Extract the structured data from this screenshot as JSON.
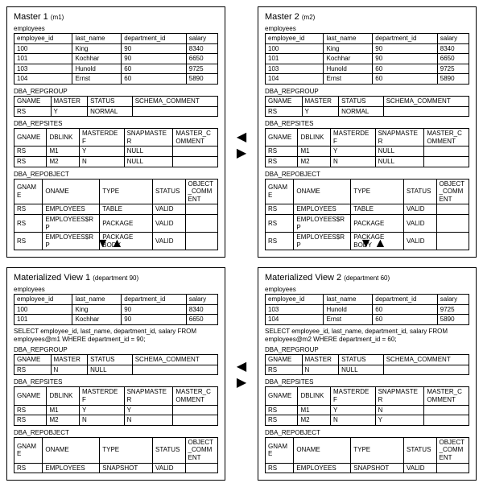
{
  "panels": {
    "master1": {
      "title": "Master 1",
      "sub": "(m1)",
      "emp_label": "employees",
      "emp_headers": [
        "employee_id",
        "last_name",
        "department_id",
        "salary"
      ],
      "emp_rows": [
        [
          "100",
          "King",
          "90",
          "8340"
        ],
        [
          "101",
          "Kochhar",
          "90",
          "6650"
        ],
        [
          "103",
          "Hunold",
          "60",
          "9725"
        ],
        [
          "104",
          "Ernst",
          "60",
          "5890"
        ]
      ],
      "repgroup_label": "DBA_REPGROUP",
      "repgroup_headers": [
        "GNAME",
        "MASTER",
        "STATUS",
        "SCHEMA_COMMENT"
      ],
      "repgroup_rows": [
        [
          "RS",
          "Y",
          "NORMAL",
          ""
        ]
      ],
      "repsites_label": "DBA_REPSITES",
      "repsites_headers": [
        "GNAME",
        "DBLINK",
        "MASTERDEF",
        "SNAPMASTER",
        "MASTER_COMMENT"
      ],
      "repsites_rows": [
        [
          "RS",
          "M1",
          "Y",
          "NULL",
          ""
        ],
        [
          "RS",
          "M2",
          "N",
          "NULL",
          ""
        ]
      ],
      "repobject_label": "DBA_REPOBJECT",
      "repobject_headers": [
        "GNAME",
        "ONAME",
        "TYPE",
        "STATUS",
        "OBJECT_COMMENT"
      ],
      "repobject_rows": [
        [
          "RS",
          "EMPLOYEES",
          "TABLE",
          "VALID",
          ""
        ],
        [
          "RS",
          "EMPLOYEES$RP",
          "PACKAGE",
          "VALID",
          ""
        ],
        [
          "RS",
          "EMPLOYEES$RP",
          "PACKAGE BODY",
          "VALID",
          ""
        ]
      ]
    },
    "master2": {
      "title": "Master 2",
      "sub": "(m2)",
      "emp_label": "employees",
      "emp_headers": [
        "employee_id",
        "last_name",
        "department_id",
        "salary"
      ],
      "emp_rows": [
        [
          "100",
          "King",
          "90",
          "8340"
        ],
        [
          "101",
          "Kochhar",
          "90",
          "6650"
        ],
        [
          "103",
          "Hunold",
          "60",
          "9725"
        ],
        [
          "104",
          "Ernst",
          "60",
          "5890"
        ]
      ],
      "repgroup_label": "DBA_REPGROUP",
      "repgroup_headers": [
        "GNAME",
        "MASTER",
        "STATUS",
        "SCHEMA_COMMENT"
      ],
      "repgroup_rows": [
        [
          "RS",
          "Y",
          "NORMAL",
          ""
        ]
      ],
      "repsites_label": "DBA_REPSITES",
      "repsites_headers": [
        "GNAME",
        "DBLINK",
        "MASTERDEF",
        "SNAPMASTER",
        "MASTER_COMMENT"
      ],
      "repsites_rows": [
        [
          "RS",
          "M1",
          "Y",
          "NULL",
          ""
        ],
        [
          "RS",
          "M2",
          "N",
          "NULL",
          ""
        ]
      ],
      "repobject_label": "DBA_REPOBJECT",
      "repobject_headers": [
        "GNAME",
        "ONAME",
        "TYPE",
        "STATUS",
        "OBJECT_COMMENT"
      ],
      "repobject_rows": [
        [
          "RS",
          "EMPLOYEES",
          "TABLE",
          "VALID",
          ""
        ],
        [
          "RS",
          "EMPLOYEES$RP",
          "PACKAGE",
          "VALID",
          ""
        ],
        [
          "RS",
          "EMPLOYEES$RP",
          "PACKAGE BODY",
          "VALID",
          ""
        ]
      ]
    },
    "mv1": {
      "title": "Materialized View 1",
      "sub": "(department 90)",
      "emp_label": "employees",
      "emp_headers": [
        "employee_id",
        "last_name",
        "department_id",
        "salary"
      ],
      "emp_rows": [
        [
          "100",
          "King",
          "90",
          "8340"
        ],
        [
          "101",
          "Kochhar",
          "90",
          "6650"
        ]
      ],
      "sql": "SELECT employee_id, last_name, department_id,\nsalary FROM employees@m1 WHERE department_id = 90;",
      "repgroup_label": "DBA_REPGROUP",
      "repgroup_headers": [
        "GNAME",
        "MASTER",
        "STATUS",
        "SCHEMA_COMMENT"
      ],
      "repgroup_rows": [
        [
          "RS",
          "N",
          "NULL",
          ""
        ]
      ],
      "repsites_label": "DBA_REPSITES",
      "repsites_headers": [
        "GNAME",
        "DBLINK",
        "MASTERDEF",
        "SNAPMASTER",
        "MASTER_COMMENT"
      ],
      "repsites_rows": [
        [
          "RS",
          "M1",
          "Y",
          "Y",
          ""
        ],
        [
          "RS",
          "M2",
          "N",
          "N",
          ""
        ]
      ],
      "repobject_label": "DBA_REPOBJECT",
      "repobject_headers": [
        "GNAME",
        "ONAME",
        "TYPE",
        "STATUS",
        "OBJECT_COMMENT"
      ],
      "repobject_rows": [
        [
          "RS",
          "EMPLOYEES",
          "SNAPSHOT",
          "VALID",
          ""
        ]
      ]
    },
    "mv2": {
      "title": "Materialized View 2",
      "sub": "(department 60)",
      "emp_label": "employees",
      "emp_headers": [
        "employee_id",
        "last_name",
        "department_id",
        "salary"
      ],
      "emp_rows": [
        [
          "103",
          "Hunold",
          "60",
          "9725"
        ],
        [
          "104",
          "Ernst",
          "60",
          "5890"
        ]
      ],
      "sql": "SELECT employee_id, last_name, department_id,\nsalary FROM employees@m2 WHERE department_id = 60;",
      "repgroup_label": "DBA_REPGROUP",
      "repgroup_headers": [
        "GNAME",
        "MASTER",
        "STATUS",
        "SCHEMA_COMMENT"
      ],
      "repgroup_rows": [
        [
          "RS",
          "N",
          "NULL",
          ""
        ]
      ],
      "repsites_label": "DBA_REPSITES",
      "repsites_headers": [
        "GNAME",
        "DBLINK",
        "MASTERDEF",
        "SNAPMASTER",
        "MASTER_COMMENT"
      ],
      "repsites_rows": [
        [
          "RS",
          "M1",
          "Y",
          "N",
          ""
        ],
        [
          "RS",
          "M2",
          "N",
          "Y",
          ""
        ]
      ],
      "repobject_label": "DBA_REPOBJECT",
      "repobject_headers": [
        "GNAME",
        "ONAME",
        "TYPE",
        "STATUS",
        "OBJECT_COMMENT"
      ],
      "repobject_rows": [
        [
          "RS",
          "EMPLOYEES",
          "SNAPSHOT",
          "VALID",
          ""
        ]
      ]
    }
  },
  "colwidths": {
    "repgroup": [
      "18%",
      "18%",
      "22%",
      "42%"
    ],
    "repsites": [
      "16%",
      "16%",
      "22%",
      "24%",
      "22%"
    ],
    "repobject": [
      "14%",
      "28%",
      "26%",
      "16%",
      "16%"
    ]
  }
}
